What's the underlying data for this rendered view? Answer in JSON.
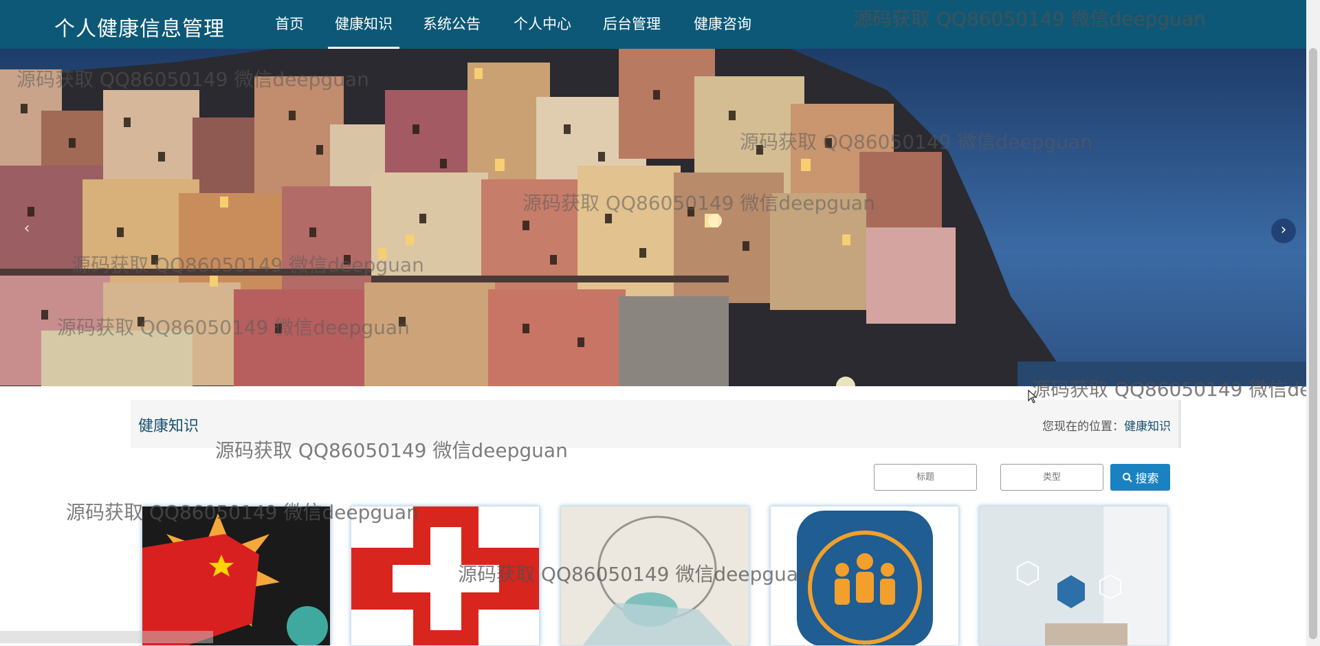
{
  "brand": "个人健康信息管理",
  "nav": [
    "首页",
    "健康知识",
    "系统公告",
    "个人中心",
    "后台管理",
    "健康咨询"
  ],
  "active_nav": "健康知识",
  "section": {
    "title": "健康知识",
    "crumb_prefix": "您现在的位置：",
    "crumb_current": "健康知识"
  },
  "search": {
    "title_placeholder": "标题",
    "type_placeholder": "类型",
    "button_label": "搜索"
  },
  "banner": {
    "prev_icon": "chevron-left-icon",
    "next_icon": "chevron-right-icon",
    "slide_count": 3
  },
  "cards": [
    {
      "image": "fist-flag-virus"
    },
    {
      "image": "red-cross"
    },
    {
      "image": "mask-sketch"
    },
    {
      "image": "medical-team-badge"
    },
    {
      "image": "doctor-data"
    }
  ],
  "watermark": "源码获取 QQ86050149 微信deepguan",
  "colors": {
    "navbar": "#0d5877",
    "accent": "#1b82c1",
    "title": "#1a4f6e"
  }
}
